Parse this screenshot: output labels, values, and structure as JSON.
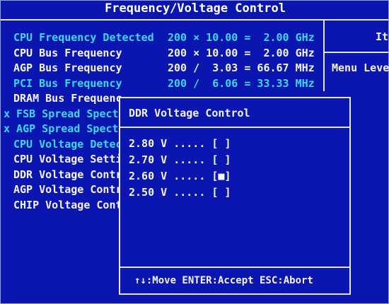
{
  "header": {
    "title": "Frequency/Voltage Control"
  },
  "help_panel": {
    "title": "It",
    "menu_level": "Menu Leve"
  },
  "settings": [
    {
      "label": "CPU Frequency Detected",
      "value": "200 × 10.00 =  2.00 GHz",
      "color": "#3fd6f0"
    },
    {
      "label": "CPU Bus Frequency",
      "value": "200 × 10.00 =  2.00 GHz",
      "color": "#f4f4ff"
    },
    {
      "label": "AGP Bus Frequency",
      "value": "200 /  3.03 = 66.67 MHz",
      "color": "#f4f4ff"
    },
    {
      "label": "PCI Bus Frequency",
      "value": "200 /  6.06 = 33.33 MHz",
      "color": "#3fd6f0"
    },
    {
      "label": "DRAM Bus Frequenc",
      "value": "",
      "color": "#f4f4ff"
    },
    {
      "label": "x FSB Spread Spectr",
      "value": "",
      "color": "#3fd6f0"
    },
    {
      "label": "x AGP Spread Spectr",
      "value": "",
      "color": "#3fd6f0"
    },
    {
      "label": "CPU Voltage Detec",
      "value": "",
      "color": "#3fd6f0"
    },
    {
      "label": "CPU Voltage Setti",
      "value": "",
      "color": "#f4f4ff"
    },
    {
      "label": "DDR Voltage Contr",
      "value": "",
      "color": "#f4f4ff"
    },
    {
      "label": "AGP Voltage Contr",
      "value": "",
      "color": "#f4f4ff"
    },
    {
      "label": "CHIP Voltage Cont",
      "value": "",
      "color": "#f4f4ff"
    }
  ],
  "popup": {
    "title": "DDR Voltage Control",
    "options": [
      {
        "text": "2.80 V ..... [ ]"
      },
      {
        "text": "2.70 V ..... [ ]"
      },
      {
        "text": "2.60 V ..... [■]"
      },
      {
        "text": "2.50 V ..... [ ]"
      }
    ],
    "footer": "↑↓:Move ENTER:Accept ESC:Abort"
  }
}
